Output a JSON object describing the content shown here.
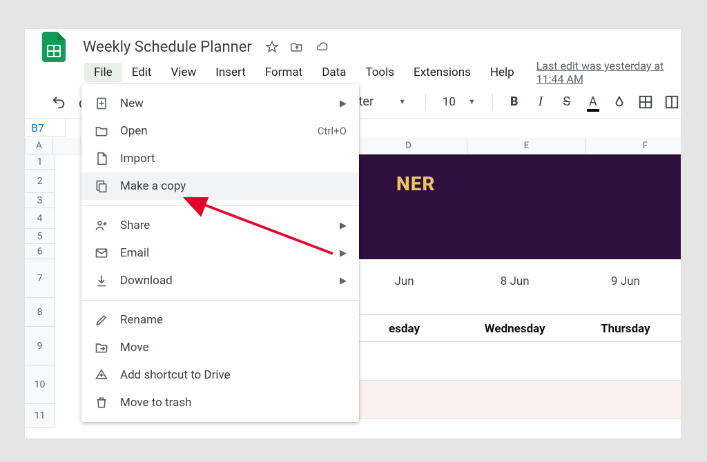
{
  "doc": {
    "title": "Weekly Schedule Planner"
  },
  "menubar": {
    "file": "File",
    "edit": "Edit",
    "view": "View",
    "insert": "Insert",
    "format": "Format",
    "data": "Data",
    "tools": "Tools",
    "extensions": "Extensions",
    "help": "Help",
    "last_edit": "Last edit was yesterday at 11:44 AM"
  },
  "toolbar": {
    "font_name": "Inter",
    "font_size": "10"
  },
  "namebox": {
    "value": "B7"
  },
  "columns": {
    "A": "A",
    "D": "D",
    "E": "E",
    "F": "F"
  },
  "row_numbers": [
    "1",
    "2",
    "3",
    "4",
    "5",
    "6",
    "7",
    "8",
    "9",
    "10",
    "11"
  ],
  "banner": {
    "title_fragment": "NER"
  },
  "schedule": {
    "dates": {
      "d": "Jun",
      "e": "8 Jun",
      "f": "9 Jun"
    },
    "days": {
      "d": "esday",
      "e": "Wednesday",
      "f": "Thursday"
    }
  },
  "file_menu": {
    "new": "New",
    "open": "Open",
    "open_shortcut": "Ctrl+O",
    "import": "Import",
    "make_copy": "Make a copy",
    "share": "Share",
    "email": "Email",
    "download": "Download",
    "rename": "Rename",
    "move": "Move",
    "add_shortcut": "Add shortcut to Drive",
    "move_trash": "Move to trash"
  }
}
